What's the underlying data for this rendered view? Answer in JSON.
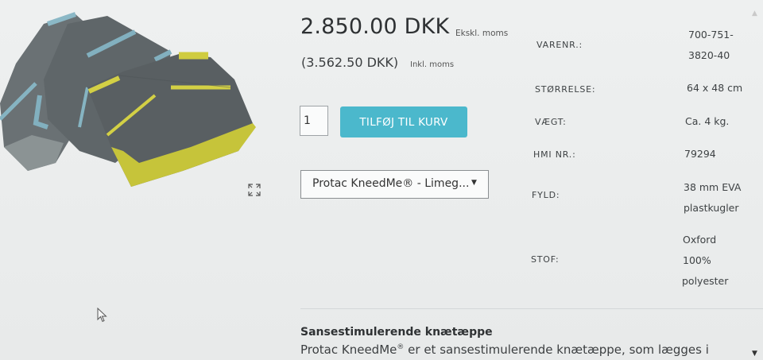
{
  "product": {
    "image_alt": "Protac KneedMe knee blanket",
    "price_excl": "2.850.00 DKK",
    "price_excl_label": "Ekskl. moms",
    "price_incl": "(3.562.50 DKK)",
    "price_incl_label": "Inkl. moms",
    "quantity": "1",
    "add_to_cart_label": "TILFØJ TIL KURV",
    "variant_selected": "Protac KneedMe® - Limeg...",
    "colors": {
      "button": "#4bb8cc",
      "product_gray": "#5c6366",
      "product_lime": "#c8c83a",
      "product_blue": "#7aaab8"
    }
  },
  "specs": [
    {
      "label": "VARENR.:",
      "value_lines": [
        "700-751-",
        "3820-40"
      ]
    },
    {
      "label": "STØRRELSE:",
      "value_lines": [
        "64 x 48 cm"
      ]
    },
    {
      "label": "VÆGT:",
      "value_lines": [
        "Ca. 4 kg."
      ]
    },
    {
      "label": "HMI NR.:",
      "value_lines": [
        "79294"
      ]
    },
    {
      "label": "FYLD:",
      "value_lines": [
        "38 mm EVA",
        "plastkugler"
      ]
    },
    {
      "label": "STOF:",
      "value_lines": [
        "Oxford",
        "100%",
        "polyester"
      ]
    }
  ],
  "description": {
    "title": "Sansestimulerende knætæppe",
    "text_before": "Protac KneedMe",
    "text_reg": "®",
    "text_after": " er et sansestimulerende knætæppe, som lægges i"
  },
  "icons": {
    "zoom": "expand-icon",
    "cursor": "mouse-cursor-icon",
    "scroll_down": "scroll-down-arrow-icon"
  }
}
